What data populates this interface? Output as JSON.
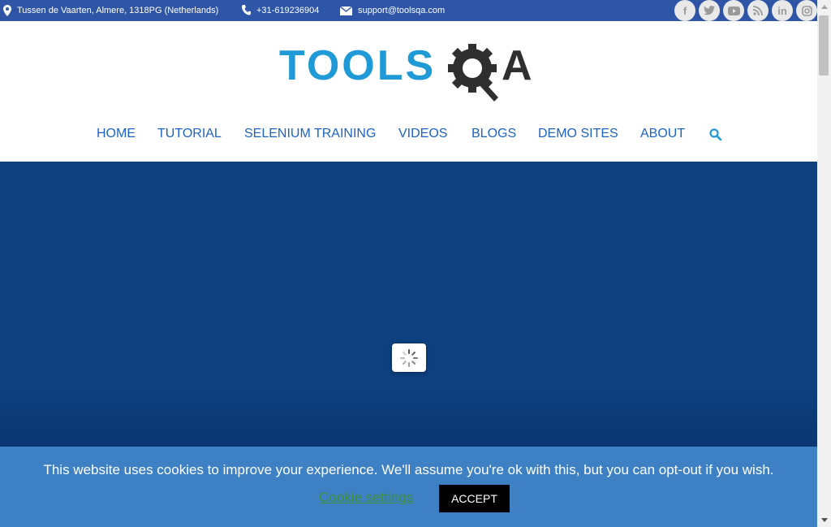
{
  "topbar": {
    "address": "Tussen de Vaarten, Almere, 1318PG (Netherlands)",
    "phone": "+31-619236904",
    "email": "support@toolsqa.com",
    "social": [
      "facebook-icon",
      "twitter-icon",
      "youtube-icon",
      "rss-icon",
      "linkedin-icon",
      "instagram-icon"
    ],
    "background": "#2f56a6"
  },
  "logo": {
    "text_tools": "TOOLS",
    "text_qa": "A",
    "colors": {
      "tools": "#1f9ad6",
      "qa": "#2f2f2f"
    }
  },
  "nav": {
    "items": [
      "HOME",
      "TUTORIAL",
      "SELENIUM TRAINING",
      "VIDEOS",
      "BLOGS",
      "DEMO SITES",
      "ABOUT"
    ],
    "color": "#1d63c7",
    "search_icon": "search-icon"
  },
  "hero": {
    "background": "#0e3f7e",
    "loader_icon": "spinner-icon"
  },
  "cookie": {
    "message": "This website uses cookies to improve your experience. We'll assume you're ok with this, but you can opt-out if you wish.",
    "settings_label": "Cookie settings",
    "accept_label": "ACCEPT",
    "background": "#3d80c4"
  }
}
